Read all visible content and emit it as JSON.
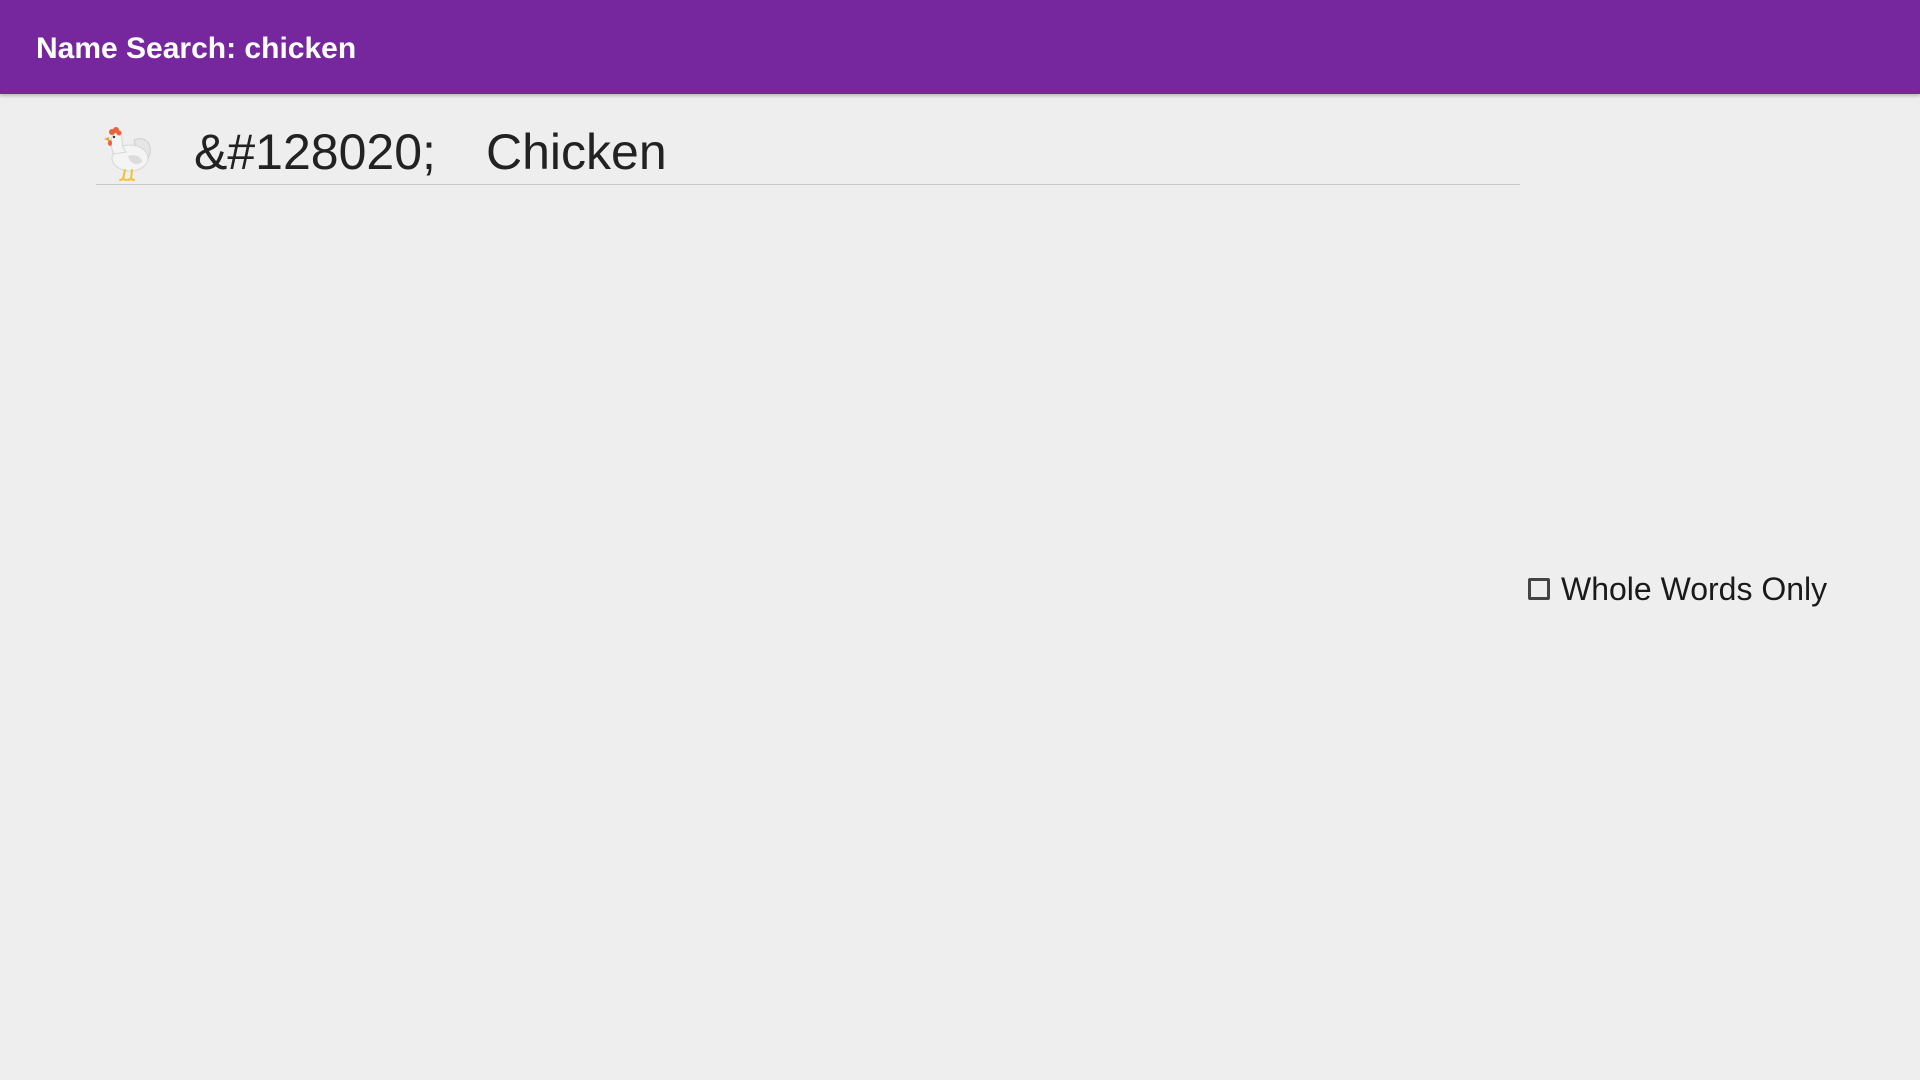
{
  "app_bar": {
    "title": "Name Search: chicken",
    "color": "#77279d"
  },
  "results": [
    {
      "icon": "chicken-emoji-icon",
      "code": "&#128020;",
      "name": "Chicken"
    }
  ],
  "options": {
    "whole_words_label": "Whole Words Only",
    "whole_words_checked": false
  }
}
